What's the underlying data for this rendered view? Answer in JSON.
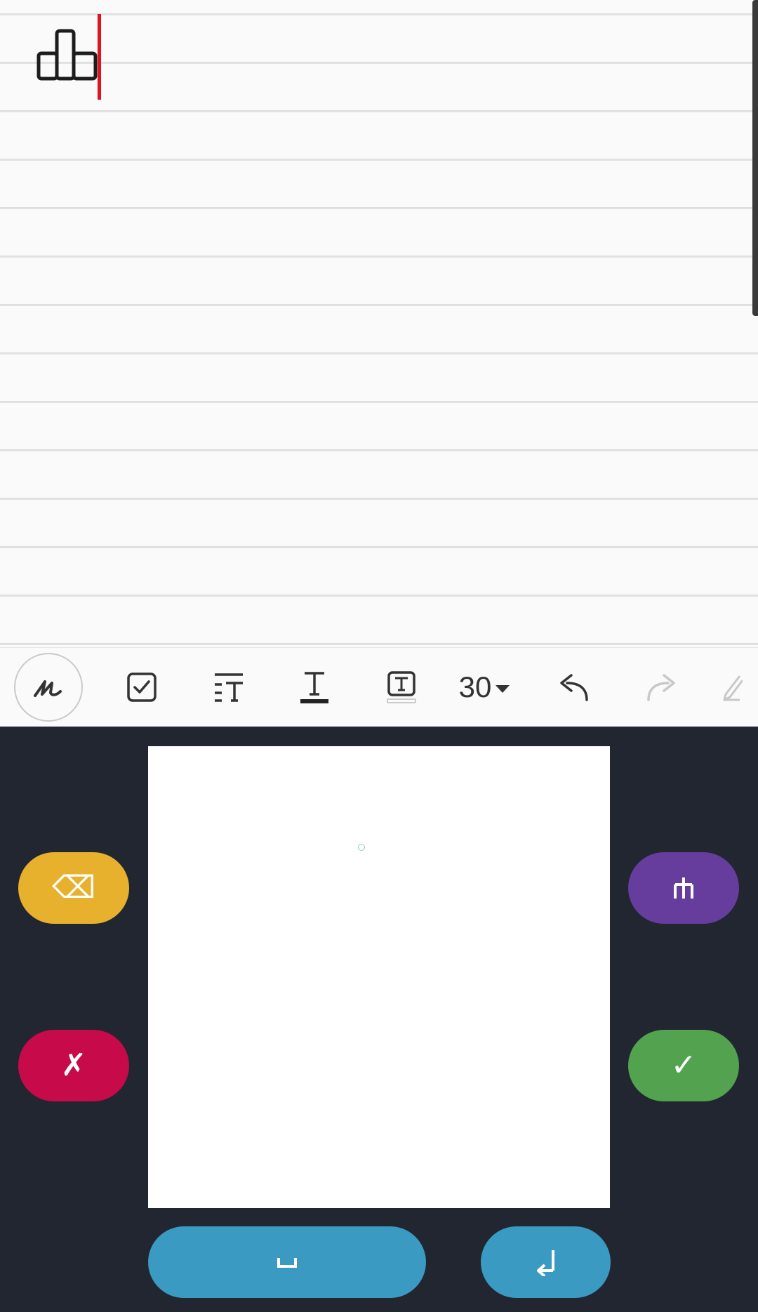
{
  "notebook": {
    "written_text": "ꝺ",
    "cursor_color": "#e0141e"
  },
  "toolbar": {
    "tools": [
      {
        "name": "pen-tool",
        "icon": "handwriting-pen-icon",
        "selected": true
      },
      {
        "name": "checkbox-tool",
        "icon": "checkbox-icon"
      },
      {
        "name": "align-text-tool",
        "icon": "text-align-icon"
      },
      {
        "name": "underline-text-tool",
        "icon": "text-underline-icon"
      },
      {
        "name": "textbox-tool",
        "icon": "textbox-icon"
      },
      {
        "name": "undo-tool",
        "icon": "undo-icon"
      },
      {
        "name": "redo-tool",
        "icon": "redo-icon",
        "disabled": true
      },
      {
        "name": "eraser-tool",
        "icon": "eraser-icon"
      }
    ],
    "font_size": "30"
  },
  "keyboard": {
    "backspace_glyph": "⌫",
    "symbol_glyph": "ᆸ",
    "cancel_glyph": "✗",
    "accept_glyph": "✓",
    "space_glyph": "␣",
    "enter_glyph": "↲",
    "colors": {
      "backspace": "#e7b12e",
      "symbol": "#663c9d",
      "cancel": "#c60a4a",
      "accept": "#53a250",
      "space": "#3a9ac2",
      "enter": "#3a9ac2",
      "background": "#212631"
    }
  }
}
